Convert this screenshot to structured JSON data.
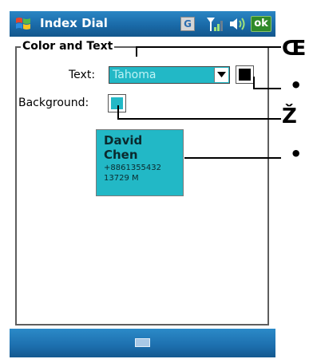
{
  "titlebar": {
    "app_title": "Index Dial",
    "g_label": "G",
    "ok_label": "ok"
  },
  "form": {
    "group_title": "Color and Text",
    "text_label": "Text:",
    "font_value": "Tahoma",
    "background_label": "Background:",
    "text_color": "#000000",
    "background_color": "#22b8c6"
  },
  "preview": {
    "line1": "David",
    "line2": "Chen",
    "line3": "+8861355432",
    "line4": "13729 M"
  },
  "callouts": {
    "c1": "Œ",
    "c2": "•",
    "c3": "Ž",
    "c4": "•"
  },
  "colors": {
    "titlebar": "#1a6aa8",
    "accent": "#22b8c6",
    "ok_green": "#2f8a2a"
  }
}
